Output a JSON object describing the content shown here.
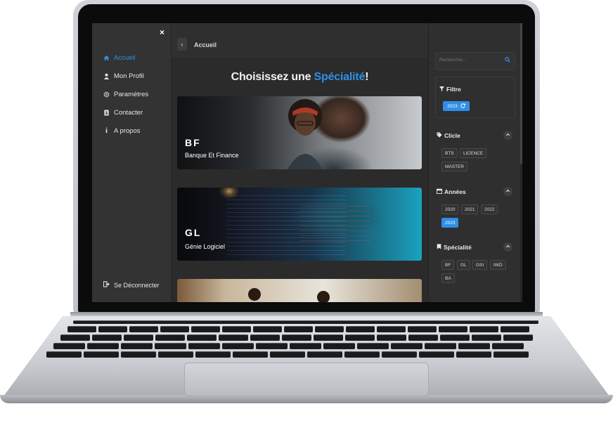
{
  "sidebar": {
    "close_label": "×",
    "items": [
      {
        "label": "Accueil",
        "icon": "home-icon",
        "active": true
      },
      {
        "label": "Mon Profil",
        "icon": "user-icon",
        "active": false
      },
      {
        "label": "Paramètres",
        "icon": "gear-icon",
        "active": false
      },
      {
        "label": "Contacter",
        "icon": "contact-icon",
        "active": false
      },
      {
        "label": "A propos",
        "icon": "info-icon",
        "active": false
      }
    ],
    "logout_label": "Se Déconnecter"
  },
  "header": {
    "back_label": "‹",
    "breadcrumb": "Accueil"
  },
  "main": {
    "headline_prefix": "Choisissez une ",
    "headline_accent": "Spécialité",
    "headline_suffix": "!",
    "cards": [
      {
        "code": "BF",
        "title": "Banque Et Finance"
      },
      {
        "code": "GL",
        "title": "Génie Logiciel"
      },
      {
        "code": "",
        "title": ""
      }
    ]
  },
  "filters": {
    "search_placeholder": "Rechercher...",
    "filter_title": "Filtre",
    "active_year": "2023",
    "cycle": {
      "title": "Clicle",
      "options": [
        "BTS",
        "LICENCE",
        "MASTER"
      ]
    },
    "years": {
      "title": "Années",
      "options": [
        "2020",
        "2021",
        "2022",
        "2023"
      ],
      "selected": "2023"
    },
    "specialite": {
      "title": "Spécialité",
      "options": [
        "BF",
        "GL",
        "GSI",
        "IWD",
        "BA"
      ]
    }
  },
  "colors": {
    "accent": "#2f8fe6",
    "panel": "#2f2f2f",
    "background": "#2b2b2b"
  }
}
